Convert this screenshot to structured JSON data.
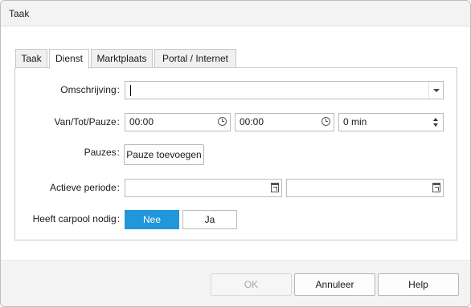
{
  "window": {
    "title": "Taak"
  },
  "tabs": [
    {
      "label": "Taak",
      "active": false
    },
    {
      "label": "Dienst",
      "active": true
    },
    {
      "label": "Marktplaats",
      "active": false
    },
    {
      "label": "Portal / Internet",
      "active": false
    }
  ],
  "form": {
    "omschrijving": {
      "label": "Omschrijving",
      "value": ""
    },
    "van_tot_pauze": {
      "label": "Van/Tot/Pauze",
      "van": "00:00",
      "tot": "00:00",
      "pauze": "0 min"
    },
    "pauzes": {
      "label": "Pauzes",
      "button": "Pauze toevoegen"
    },
    "actieve_periode": {
      "label": "Actieve periode",
      "start": "",
      "end": ""
    },
    "carpool": {
      "label": "Heeft carpool nodig",
      "options": [
        "Nee",
        "Ja"
      ],
      "selected": "Nee"
    },
    "colon": ":"
  },
  "footer": {
    "ok": "OK",
    "annuleer": "Annuleer",
    "help": "Help"
  },
  "colors": {
    "accent": "#2196d9",
    "titlebar": "#f3f3f3",
    "footer": "#f3f3f3"
  }
}
